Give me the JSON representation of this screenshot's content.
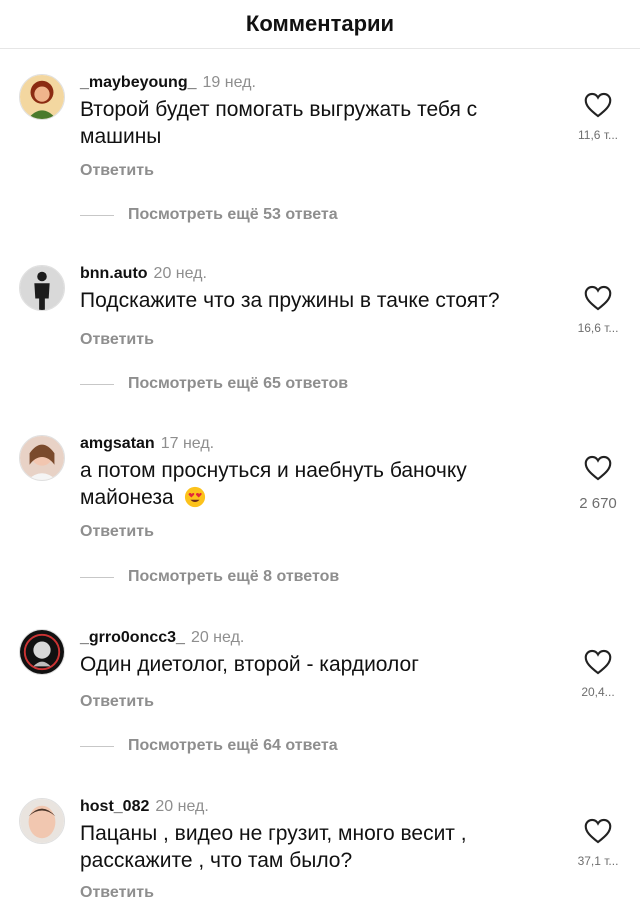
{
  "header": {
    "title": "Комментарии"
  },
  "comments": [
    {
      "username": "_maybeyoung_",
      "time": "19 нед.",
      "text": "Второй будет помогать выгружать тебя с машины",
      "reply_label": "Ответить",
      "view_more": "Посмотреть ещё 53 ответа",
      "likes": "11,6 т..."
    },
    {
      "username": "bnn.auto",
      "time": "20 нед.",
      "text": "Подскажите что за пружины в тачке стоят?",
      "reply_label": "Ответить",
      "view_more": "Посмотреть ещё 65 ответов",
      "likes": "16,6 т..."
    },
    {
      "username": "amgsatan",
      "time": "17 нед.",
      "text": "а потом проснуться и наебнуть баночку майонеза",
      "reply_label": "Ответить",
      "view_more": "Посмотреть ещё 8 ответов",
      "likes": "2 670"
    },
    {
      "username": "_grro0oncc3_",
      "time": "20 нед.",
      "text": "Один диетолог, второй - кардиолог",
      "reply_label": "Ответить",
      "view_more": "Посмотреть ещё 64 ответа",
      "likes": "20,4..."
    },
    {
      "username": "host_082",
      "time": "20 нед.",
      "text": "Пацаны , видео не грузит,  много весит , расскажите , что там было?",
      "reply_label": "Ответить",
      "likes": "37,1 т..."
    }
  ]
}
